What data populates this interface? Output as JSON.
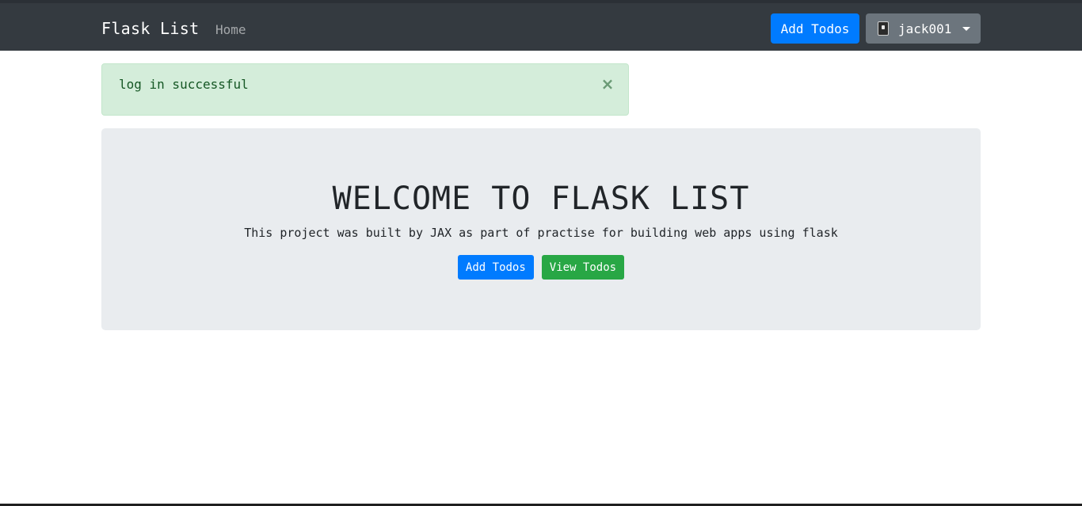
{
  "navbar": {
    "brand": "Flask List",
    "home_link": "Home",
    "add_todos": "Add Todos",
    "user_menu": "jack001",
    "user_icon": "book-icon"
  },
  "alert": {
    "message": "log in successful",
    "close": "×"
  },
  "jumbotron": {
    "title": "WELCOME TO FLASK LIST",
    "subtitle": "This project was built by JAX as part of practise for building web apps using flask",
    "add_button": "Add Todos",
    "view_button": "View Todos"
  },
  "colors": {
    "navbar_bg": "#343a40",
    "primary": "#007bff",
    "secondary": "#6c757d",
    "success": "#28a745",
    "alert_bg": "#d4edda",
    "jumbotron_bg": "#e9ecef"
  }
}
